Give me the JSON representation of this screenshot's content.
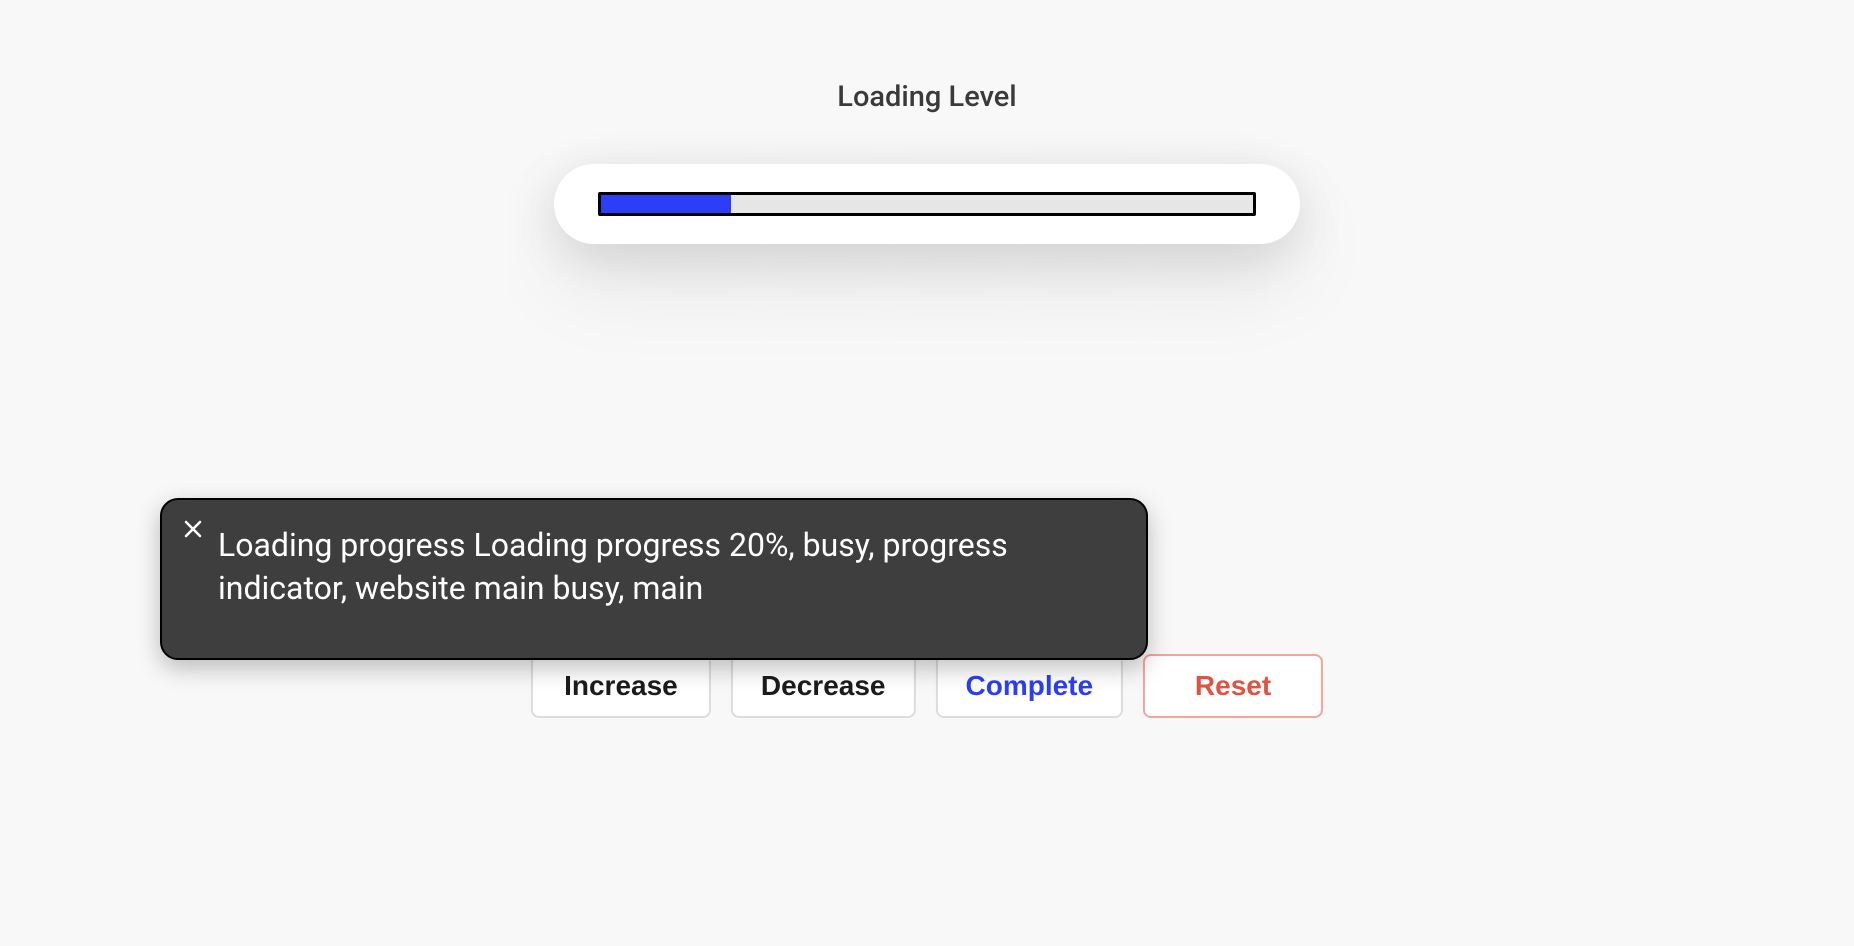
{
  "heading": "Loading Level",
  "progress": {
    "percent": 20
  },
  "buttons": {
    "increase": "Increase",
    "decrease": "Decrease",
    "complete": "Complete",
    "reset": "Reset"
  },
  "tooltip": {
    "text": "Loading progress Loading progress 20%, busy, progress indicator, website main busy, main"
  }
}
